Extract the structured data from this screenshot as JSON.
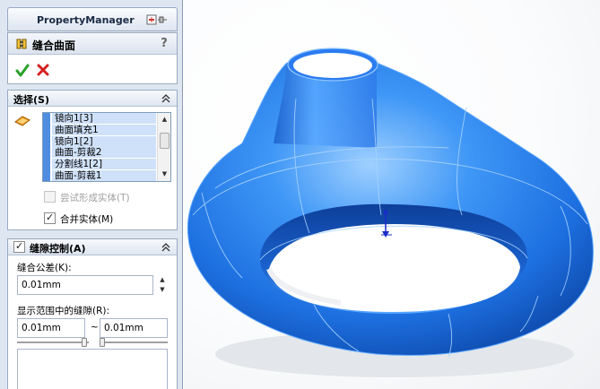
{
  "property_manager": {
    "title": "PropertyManager",
    "feature_name": "缝合曲面",
    "help_symbol": "?"
  },
  "selection": {
    "title": "选择(S)",
    "items": [
      "镜向1[3]",
      "曲面填充1",
      "镜向1[2]",
      "曲面-剪裁2",
      "分割线1[2]",
      "曲面-剪裁1"
    ],
    "try_solid_label": "尝试形成实体(T)",
    "try_solid_checked": false,
    "try_solid_enabled": false,
    "merge_label": "合并实体(M)",
    "merge_checked": true
  },
  "gap_control": {
    "title": "缝隙控制(A)",
    "checked": true,
    "tolerance_label": "缝合公差(K):",
    "tolerance_value": "0.01mm",
    "range_label": "显示范围中的缝隙(R):",
    "range_min": "0.01mm",
    "range_max": "0.01mm",
    "range_separator": "~"
  },
  "viewport": {
    "icon_names": [
      "triad-icon"
    ],
    "model_color": "#2b7cf0"
  }
}
